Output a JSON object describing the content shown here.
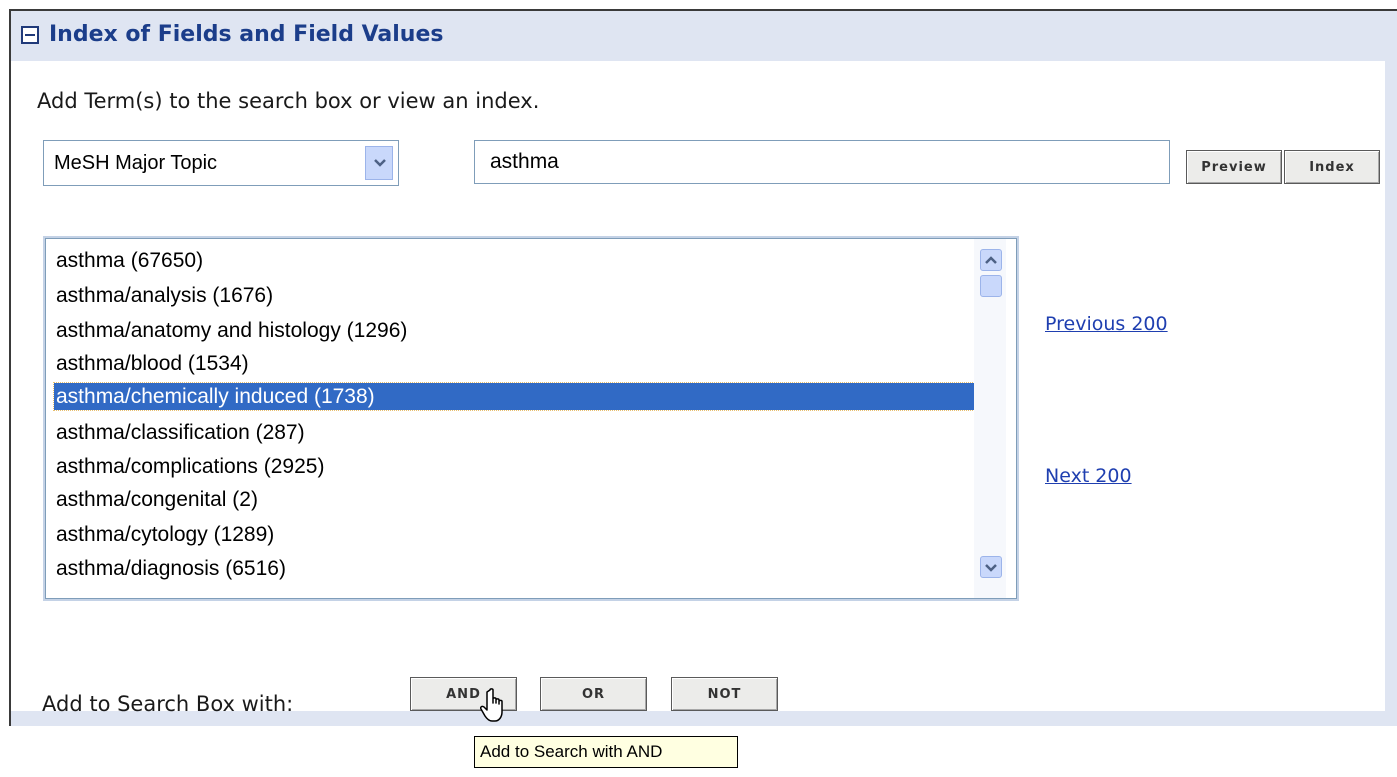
{
  "panel": {
    "title": "Index of Fields and Field Values",
    "instructions": "Add Term(s) to the search box or view an index."
  },
  "field_select": {
    "value": "MeSH Major Topic"
  },
  "search": {
    "value": "asthma"
  },
  "buttons": {
    "preview": "Preview",
    "index": "Index",
    "and": "AND",
    "or": "OR",
    "not": "NOT"
  },
  "results": {
    "items": [
      "asthma (67650)",
      "asthma/analysis (1676)",
      "asthma/anatomy and histology (1296)",
      "asthma/blood (1534)",
      "asthma/chemically induced (1738)",
      "asthma/classification (287)",
      "asthma/complications (2925)",
      "asthma/congenital (2)",
      "asthma/cytology (1289)",
      "asthma/diagnosis (6516)"
    ],
    "selected": "asthma/chemically induced (1738)"
  },
  "nav": {
    "previous": "Previous 200",
    "next": "Next 200"
  },
  "add_box": {
    "label": "Add to Search Box with:"
  },
  "tooltip": {
    "text": "Add to Search with AND"
  },
  "colors": {
    "header_bg": "#dfe5f2",
    "header_text": "#1b3d8a",
    "selection": "#316ac5",
    "link": "#1f3fb0"
  },
  "icons": {
    "collapse": "minus-box-icon",
    "dropdown": "chevron-down-icon",
    "scroll_up": "chevron-up-icon",
    "scroll_down": "chevron-down-icon",
    "cursor": "hand-pointer-icon"
  }
}
